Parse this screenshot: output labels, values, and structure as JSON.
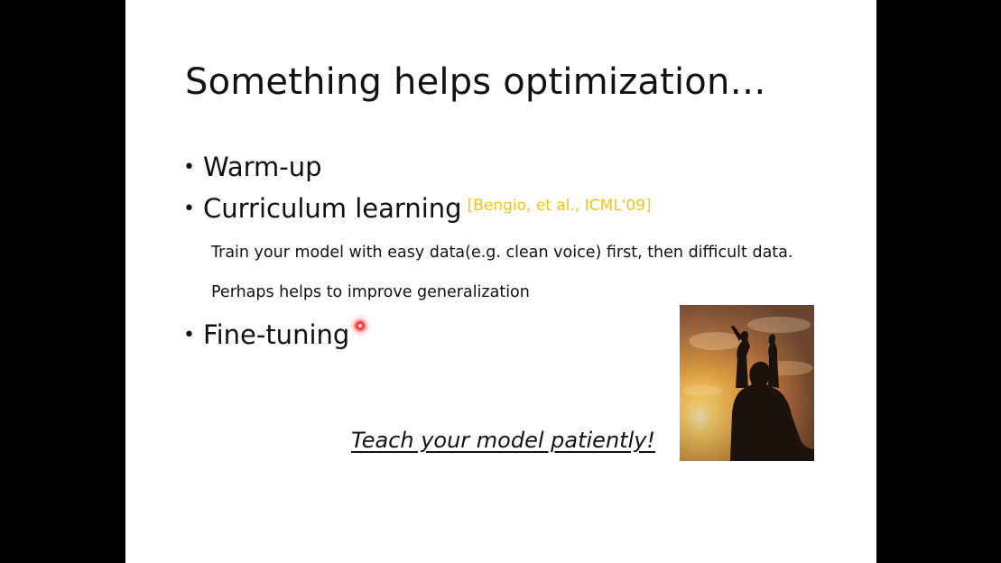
{
  "slide": {
    "title": "Something helps optimization…",
    "bullets": [
      {
        "text": "Warm-up"
      },
      {
        "text": "Curriculum learning",
        "ref": "[Bengio, et al., ICML'09]"
      },
      {
        "text": "Fine-tuning"
      }
    ],
    "sub_points": [
      "Train your model with easy data(e.g. clean voice) first, then difficult data.",
      "Perhaps helps to improve generalization"
    ],
    "bullet_glyph": "•",
    "tagline": "Teach your model patiently!",
    "image": {
      "icon": "sunset-silhouette-image"
    },
    "colors": {
      "reference": "#f0c419",
      "pointer": "#ff3b3b",
      "letterbox": "#000000",
      "slide_background": "#ffffff"
    }
  }
}
